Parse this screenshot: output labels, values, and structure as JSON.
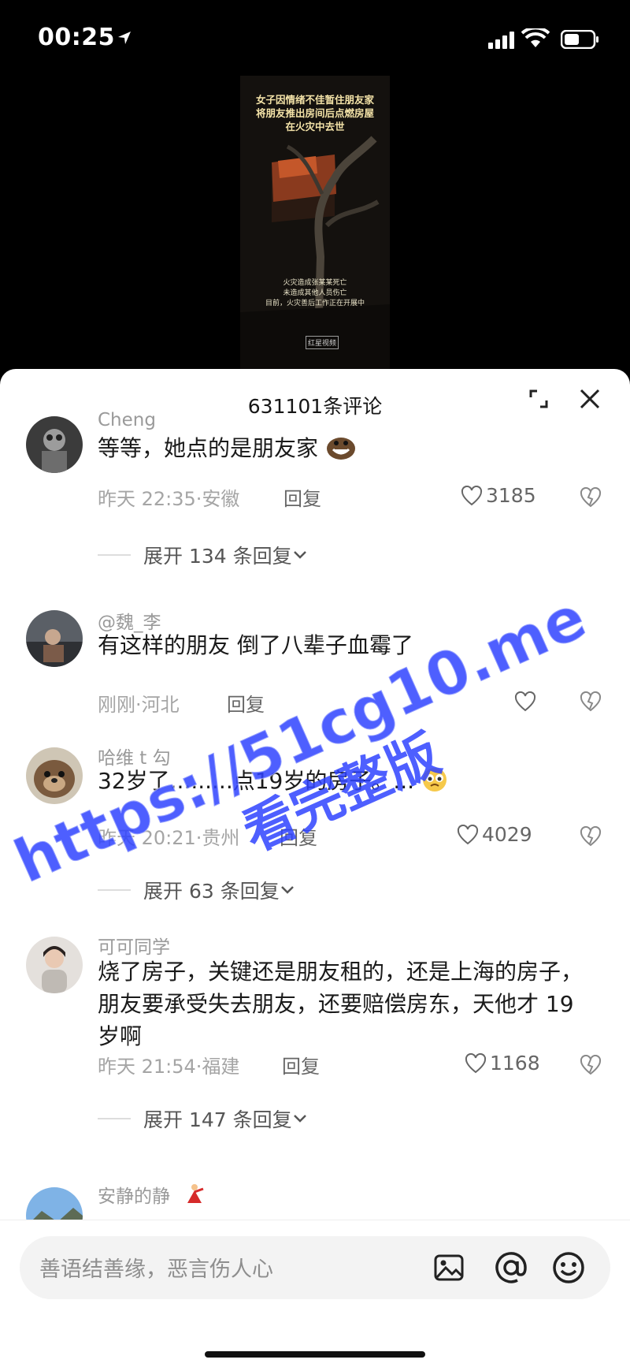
{
  "status_bar": {
    "time": "00:25"
  },
  "video": {
    "title_lines": [
      "女子因情绪不佳暂住朋友家",
      "将朋友推出房间后点燃房屋",
      "在火灾中去世"
    ],
    "caption_lines": [
      "火灾造成张某某死亡",
      "未造成其他人员伤亡",
      "目前，火灾善后工作正在开展中"
    ],
    "logo": "红星视频"
  },
  "sheet": {
    "title": "631101条评论"
  },
  "comments": [
    {
      "username": "Cheng",
      "text": "等等，她点的是朋友家",
      "time": "昨天 22:35",
      "location": "安徽",
      "reply": "回复",
      "likes": "3185",
      "expand": "展开 134 条回复"
    },
    {
      "username": "@魏_李",
      "text": "有这样的朋友 倒了八辈子血霉了",
      "time": "刚刚",
      "location": "河北",
      "reply": "回复",
      "likes": "",
      "expand": ""
    },
    {
      "username": "哈维 t 勾",
      "text": "32岁了.........点19岁的房子。...",
      "time": "昨天 20:21",
      "location": "贵州",
      "reply": "回复",
      "likes": "4029",
      "expand": "展开 63 条回复"
    },
    {
      "username": "可可同学",
      "text": "烧了房子，关键还是朋友租的，还是上海的房子，朋友要承受失去朋友，还要赔偿房东，天他才 19 岁啊",
      "time": "昨天 21:54",
      "location": "福建",
      "reply": "回复",
      "likes": "1168",
      "expand": "展开 147 条回复"
    },
    {
      "username": "安静的静",
      "text": "",
      "time": "",
      "location": "",
      "reply": "",
      "likes": "",
      "expand": ""
    }
  ],
  "input": {
    "placeholder": "善语结善缘，恶言伤人心"
  },
  "watermark": {
    "line1": "https://51cg10.me",
    "line2": "看完整版"
  },
  "colors": {
    "accent": "#2f43ff",
    "sheet_bg": "#ffffff"
  },
  "icons": [
    "location-arrow-icon",
    "signal-icon",
    "wifi-icon",
    "battery-icon",
    "expand-icon",
    "close-icon",
    "heart-icon",
    "broken-heart-icon",
    "chevron-down-icon",
    "image-icon",
    "at-icon",
    "emoji-icon"
  ]
}
